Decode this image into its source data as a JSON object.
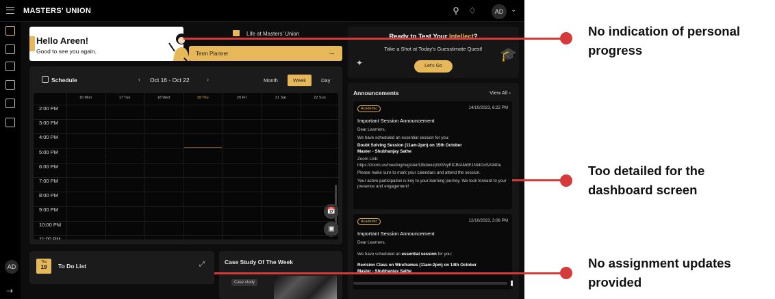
{
  "topbar": {
    "brand": "MASTERS' UNION",
    "avatar": "AD",
    "icons": [
      "search-icon",
      "bell-icon",
      "chevron-down-icon"
    ]
  },
  "sidebar": {
    "avatar": "AD",
    "icons": [
      "home-icon",
      "book-icon",
      "graduation-cap-icon",
      "badge-icon",
      "chat-icon",
      "id-card-icon",
      "logout-icon"
    ]
  },
  "hello": {
    "title": "Hello Areen!",
    "subtitle": "Good to see you again."
  },
  "life": {
    "title": "Life at Masters' Union",
    "button": "Term Planner"
  },
  "schedule": {
    "title": "Schedule",
    "range": "Oct 16 - Oct 22",
    "views": [
      "Month",
      "Week",
      "Day"
    ],
    "active_view": "Week",
    "days": [
      "16 Mon",
      "17 Tue",
      "18 Wed",
      "19 Thu",
      "20 Fri",
      "21 Sat",
      "22 Sun"
    ],
    "current_day": "19 Thu",
    "times": [
      "2:00 PM",
      "3:00 PM",
      "4:00 PM",
      "5:00 PM",
      "6:00 PM",
      "7:00 PM",
      "8:00 PM",
      "9:00 PM",
      "10:00 PM",
      "11:00 PM"
    ]
  },
  "todo": {
    "cal_month": "Thu",
    "cal_day": "19",
    "title": "To Do List"
  },
  "case": {
    "title": "Case Study Of The Week",
    "tag": "Case study"
  },
  "quest": {
    "title_pre": "Ready to Test Your ",
    "title_accent": "Intellect",
    "title_post": "?",
    "subtitle": "Take a Shot at Today's Guesstimate Quest!",
    "button": "Let's Go"
  },
  "announcements": {
    "title": "Announcements",
    "view_all": "View All",
    "items": [
      {
        "tag": "Academic",
        "date": "14/10/2023, 6:22 PM",
        "heading": "Important Session Announcement",
        "greeting": "Dear Learners,",
        "line1": "We have scheduled an essential session for you:",
        "session": "Doubt Solving Session (11am-2pm) on 15th October",
        "master": "Master - Shubhanjay Sathe",
        "zoom_label": "Zoom Link:",
        "zoom_url": "https://zoom.us/meeting/register/tJIkdeiurjGIGNyEICBtAMdE1Nt4OoSA940e",
        "line2": "Please make sure to mark your calendars and attend the session.",
        "line3": "Your active participation is key to your learning journey. We look forward to your presence and engagement!"
      },
      {
        "tag": "Academic",
        "date": "12/10/2023, 3:06 PM",
        "heading": "Important Session Announcement",
        "greeting": "Dear Learners,",
        "line1_pre": "We have scheduled an ",
        "line1_bold": "essential session",
        "line1_post": " for you:",
        "session": "Revision Class on Wireframes (11am-2pm) on 14th October",
        "master": "Master - Shubhanjay Sathe"
      }
    ]
  },
  "notes": [
    {
      "text": "No indication of personal progress"
    },
    {
      "text": "Too detailed for the dashboard screen"
    },
    {
      "text": "No assignment updates provided"
    }
  ],
  "colors": {
    "accent": "#e7b85a",
    "callout": "#d63a3a",
    "background": "#0d0d0d"
  }
}
